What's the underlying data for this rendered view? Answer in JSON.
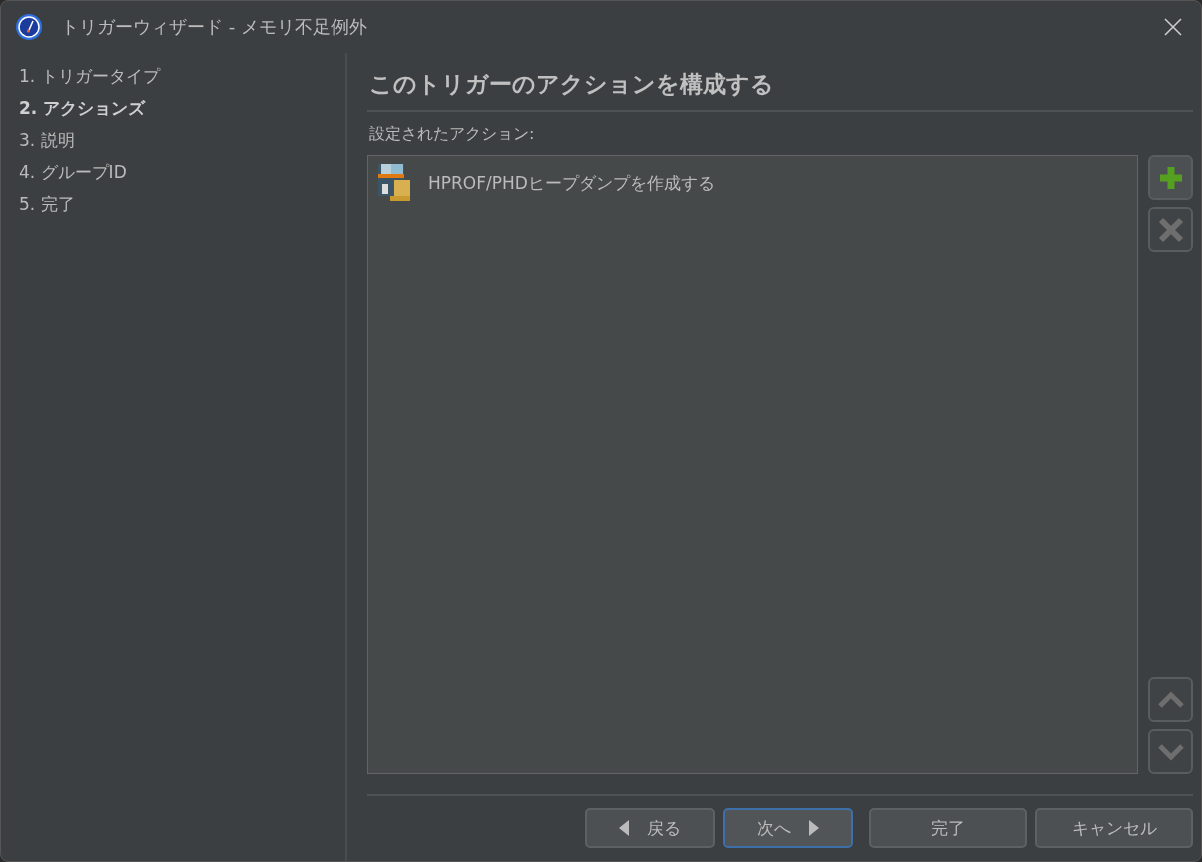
{
  "window": {
    "title": "トリガーウィザード - メモリ不足例外"
  },
  "steps": [
    {
      "label": "1. トリガータイプ",
      "selected": false
    },
    {
      "label": "2. アクションズ",
      "selected": true
    },
    {
      "label": "3. 説明",
      "selected": false
    },
    {
      "label": "4. グループID",
      "selected": false
    },
    {
      "label": "5. 完了",
      "selected": false
    }
  ],
  "heading": "このトリガーのアクションを構成する",
  "actions_label": "設定されたアクション:",
  "actions": [
    {
      "label": "HPROF/PHDヒープダンプを作成する"
    }
  ],
  "side_buttons": [
    {
      "kind": "add",
      "disabled": false
    },
    {
      "kind": "remove",
      "disabled": true
    },
    {
      "kind": "spacer"
    },
    {
      "kind": "up",
      "disabled": true
    },
    {
      "kind": "down",
      "disabled": true
    }
  ],
  "buttons": [
    {
      "kind": "back",
      "label": "戻る",
      "focused": false
    },
    {
      "kind": "next",
      "label": "次へ",
      "focused": true
    },
    {
      "kind": "finish",
      "label": "完了",
      "focused": false
    },
    {
      "kind": "cancel",
      "label": "キャンセル",
      "focused": false
    }
  ]
}
